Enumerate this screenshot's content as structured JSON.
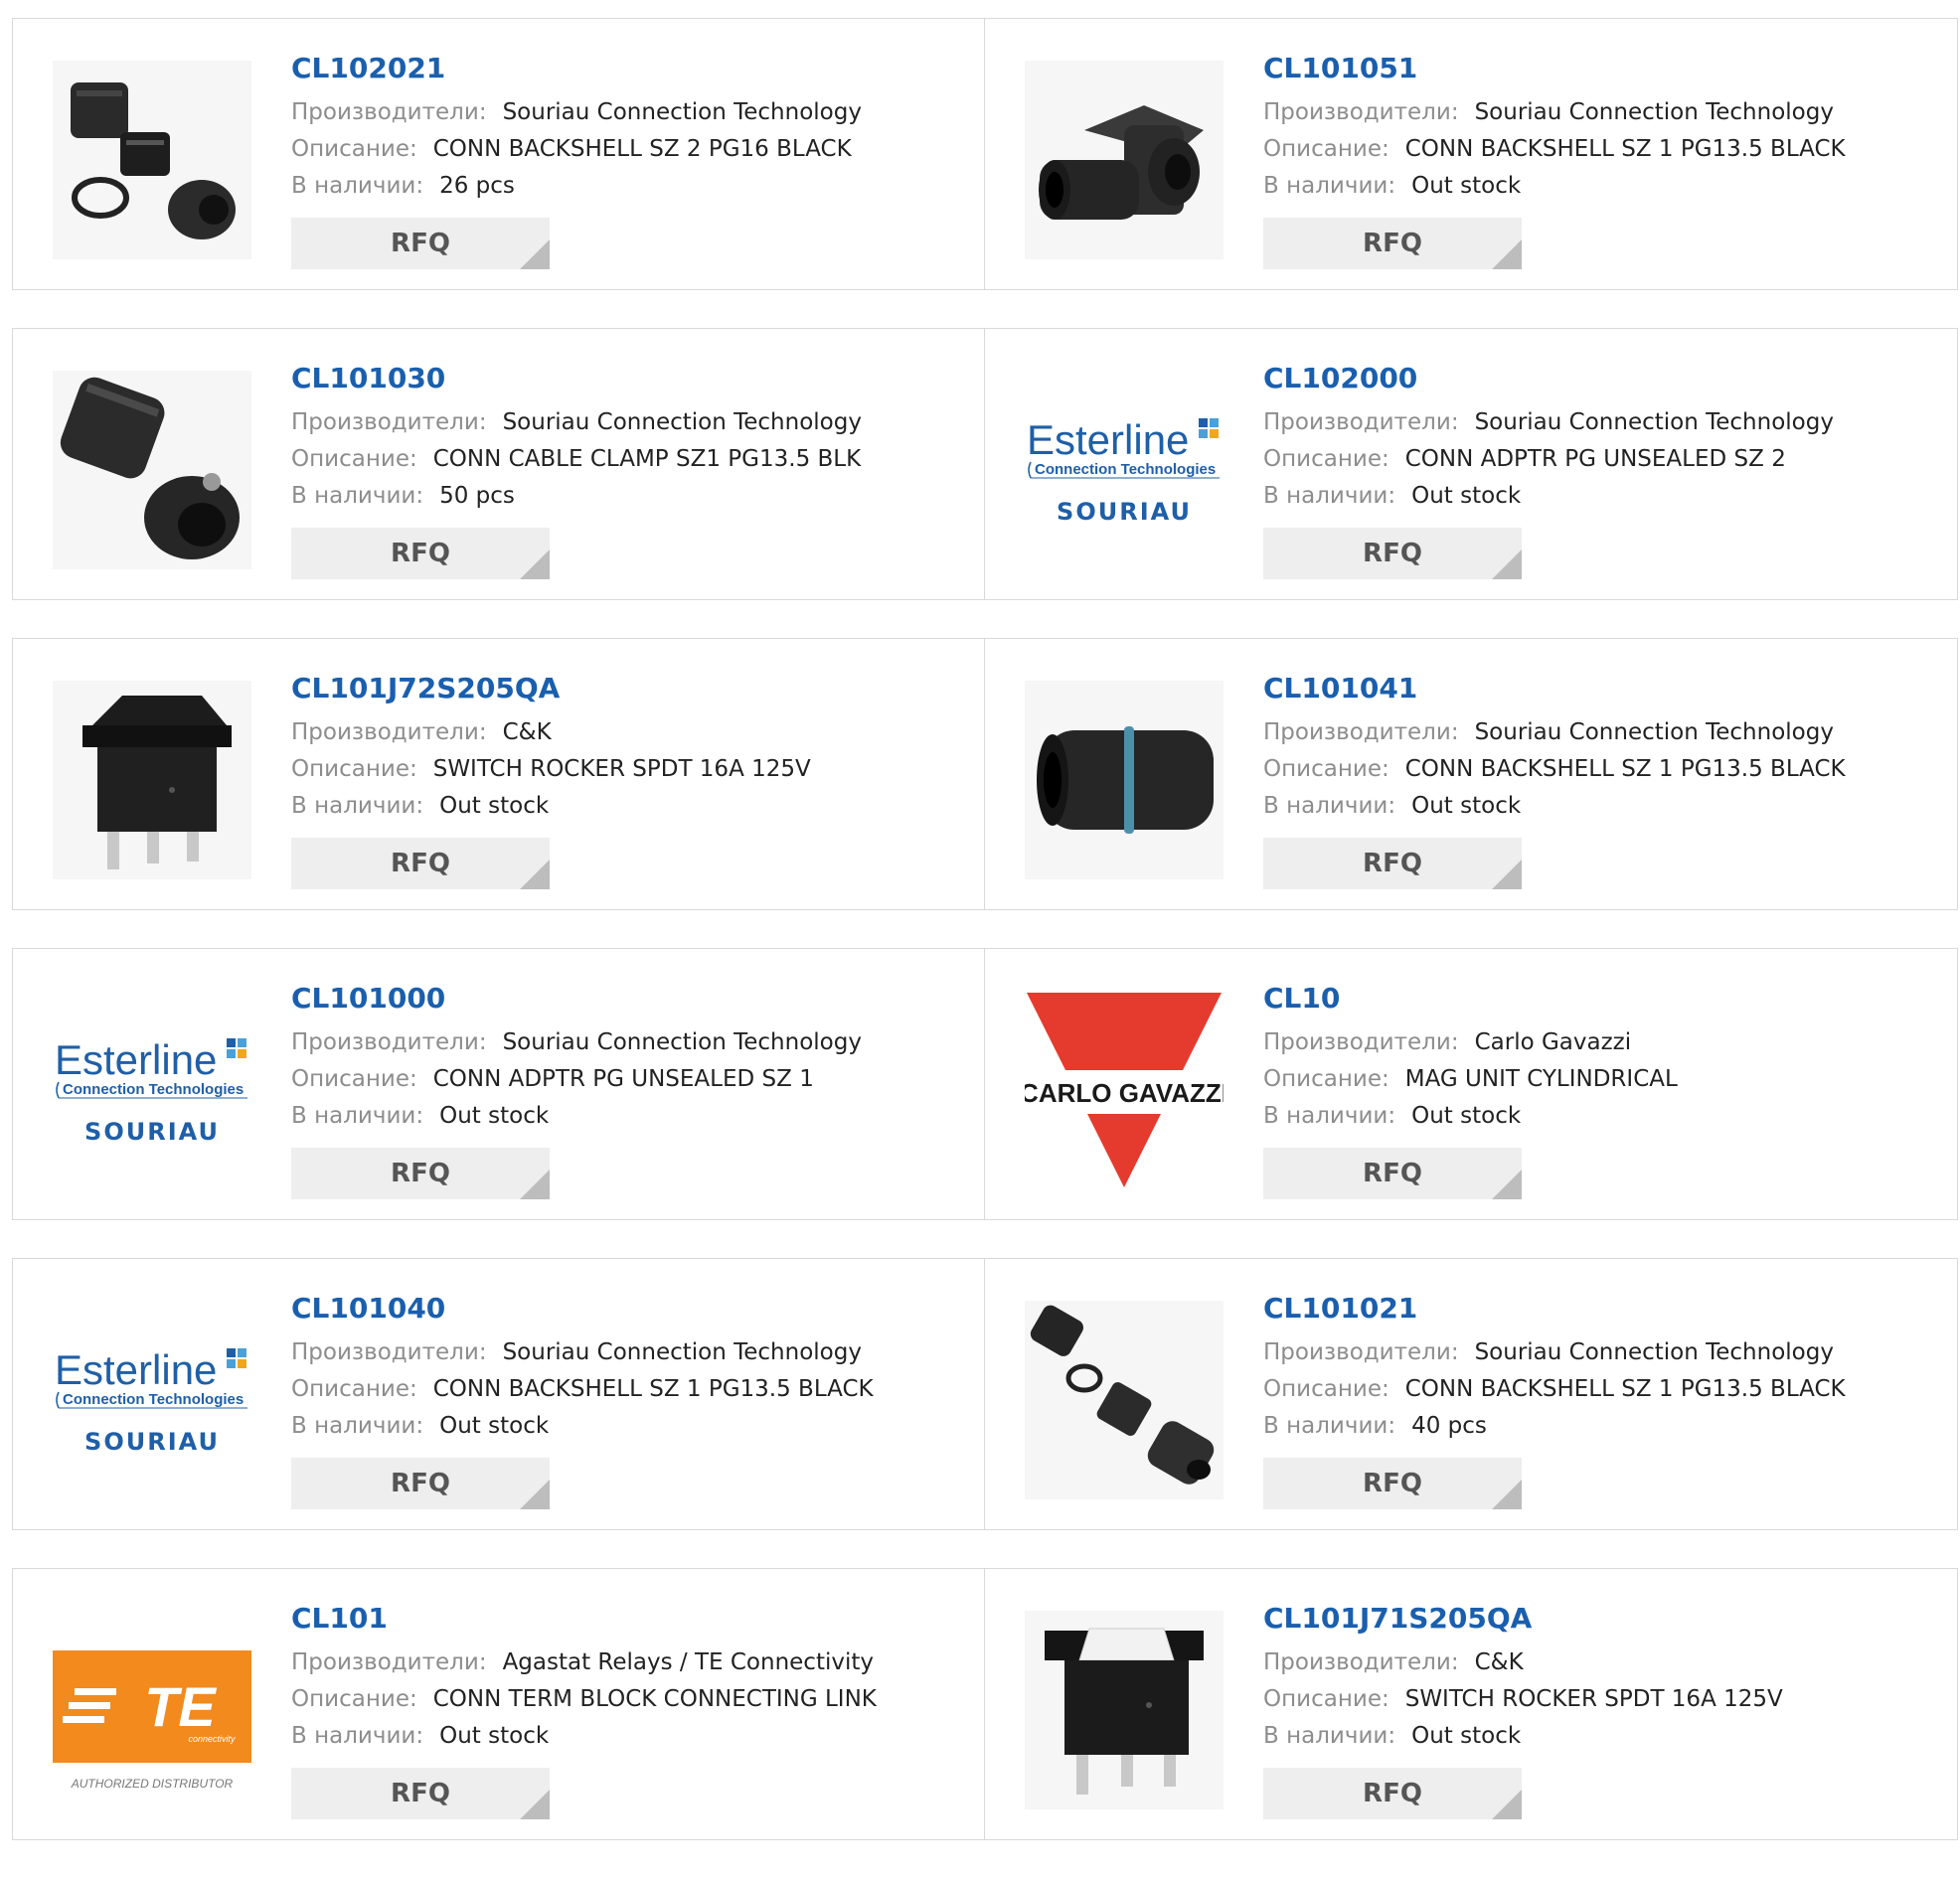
{
  "labels": {
    "manufacturer": "Производители:",
    "description": "Описание:",
    "stock": "В наличии:",
    "rfq": "RFQ"
  },
  "logos": {
    "esterline": "Esterline",
    "esterline_sub": "Connection Technologies",
    "souriau": "SOURIAU",
    "carlo_gavazzi": "CARLO GAVAZZI",
    "te": "TE",
    "te_sub": "connectivity",
    "te_authorized": "AUTHORIZED DISTRIBUTOR"
  },
  "colors": {
    "part_link": "#1a5fae",
    "label_gray": "#8d8d8d",
    "rfq_bg": "#eeeeee",
    "esterline_blue": "#1f5fa8",
    "carlo_red": "#e53b2f",
    "te_orange": "#f28a1e"
  },
  "products": [
    {
      "part": "CL102021",
      "manufacturer": "Souriau Connection Technology",
      "description": "CONN BACKSHELL SZ 2 PG16 BLACK",
      "stock": "26 pcs",
      "image": "backshell-kit-photo"
    },
    {
      "part": "CL101051",
      "manufacturer": "Souriau Connection Technology",
      "description": "CONN BACKSHELL SZ 1 PG13.5 BLACK",
      "stock": "Out stock",
      "image": "right-angle-backshell-photo"
    },
    {
      "part": "CL101030",
      "manufacturer": "Souriau Connection Technology",
      "description": "CONN CABLE CLAMP SZ1 PG13.5 BLK",
      "stock": "50 pcs",
      "image": "cable-clamp-photo"
    },
    {
      "part": "CL102000",
      "manufacturer": "Souriau Connection Technology",
      "description": "CONN ADPTR PG UNSEALED SZ 2",
      "stock": "Out stock",
      "image": "esterline-souriau-logo"
    },
    {
      "part": "CL101J72S205QA",
      "manufacturer": "C&K",
      "description": "SWITCH ROCKER SPDT 16A 125V",
      "stock": "Out stock",
      "image": "black-rocker-switch-photo"
    },
    {
      "part": "CL101041",
      "manufacturer": "Souriau Connection Technology",
      "description": "CONN BACKSHELL SZ 1 PG13.5 BLACK",
      "stock": "Out stock",
      "image": "straight-backshell-photo"
    },
    {
      "part": "CL101000",
      "manufacturer": "Souriau Connection Technology",
      "description": "CONN ADPTR PG UNSEALED SZ 1",
      "stock": "Out stock",
      "image": "esterline-souriau-logo"
    },
    {
      "part": "CL10",
      "manufacturer": "Carlo Gavazzi",
      "description": "MAG UNIT CYLINDRICAL",
      "stock": "Out stock",
      "image": "carlo-gavazzi-logo"
    },
    {
      "part": "CL101040",
      "manufacturer": "Souriau Connection Technology",
      "description": "CONN BACKSHELL SZ 1 PG13.5 BLACK",
      "stock": "Out stock",
      "image": "esterline-souriau-logo"
    },
    {
      "part": "CL101021",
      "manufacturer": "Souriau Connection Technology",
      "description": "CONN BACKSHELL SZ 1 PG13.5 BLACK",
      "stock": "40 pcs",
      "image": "exploded-backshell-photo"
    },
    {
      "part": "CL101",
      "manufacturer": "Agastat Relays / TE Connectivity",
      "description": "CONN TERM BLOCK CONNECTING LINK",
      "stock": "Out stock",
      "image": "te-connectivity-logo"
    },
    {
      "part": "CL101J71S205QA",
      "manufacturer": "C&K",
      "description": "SWITCH ROCKER SPDT 16A 125V",
      "stock": "Out stock",
      "image": "white-rocker-switch-photo"
    }
  ]
}
